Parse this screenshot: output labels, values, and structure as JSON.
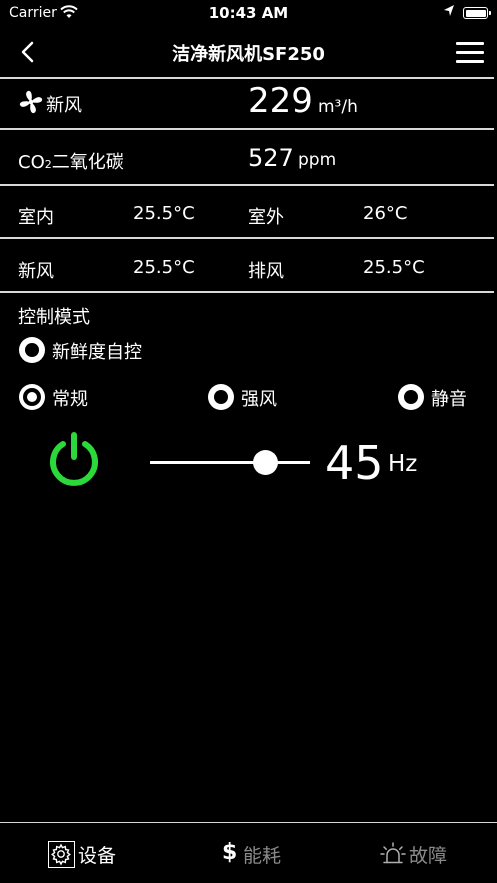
{
  "status_bar": {
    "carrier": "Carrier",
    "time": "10:43 AM"
  },
  "nav": {
    "title": "洁净新风机SF250"
  },
  "rows": {
    "fresh_air": {
      "label": "新风",
      "value": "229",
      "unit": "m³/h"
    },
    "co2": {
      "label_prefix": "CO",
      "label_sub": "2",
      "label_suffix": "二氧化碳",
      "value": "527",
      "unit": "ppm"
    },
    "temps1": {
      "label1": "室内",
      "value1": "25.5°C",
      "label2": "室外",
      "value2": "26°C"
    },
    "temps2": {
      "label1": "新风",
      "value1": "25.5°C",
      "label2": "排风",
      "value2": "25.5°C"
    }
  },
  "control": {
    "title": "控制模式",
    "auto_label": "新鲜度自控",
    "modes": [
      {
        "label": "常规",
        "selected": true
      },
      {
        "label": "强风",
        "selected": false
      },
      {
        "label": "静音",
        "selected": false
      }
    ]
  },
  "speed": {
    "value": "45",
    "unit": "Hz",
    "level": 0.72,
    "power_color": "#2bd93a"
  },
  "tabs": [
    {
      "label": "设备",
      "icon": "gear-icon",
      "active": true
    },
    {
      "label": "能耗",
      "icon": "dollar-icon",
      "active": false
    },
    {
      "label": "故障",
      "icon": "alarm-icon",
      "active": false
    }
  ]
}
